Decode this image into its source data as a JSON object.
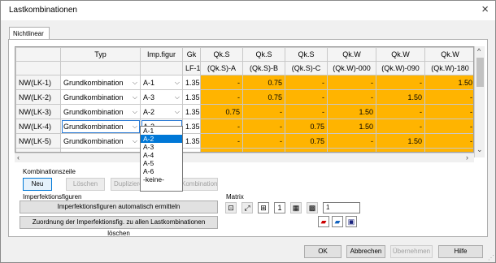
{
  "window": {
    "title": "Lastkombinationen"
  },
  "tabs": [
    {
      "label": "Nichtlinear"
    }
  ],
  "table": {
    "headers_top": [
      "",
      "Typ",
      "Imp.figur",
      "Gk",
      "Qk.S",
      "Qk.S",
      "Qk.S",
      "Qk.W",
      "Qk.W",
      "Qk.W"
    ],
    "headers_sub": [
      "",
      "",
      "",
      "LF-1",
      "(Qk.S)-A",
      "(Qk.S)-B",
      "(Qk.S)-C",
      "(Qk.W)-000",
      "(Qk.W)-090",
      "(Qk.W)-180"
    ],
    "rows": [
      {
        "name": "NW(LK-1)",
        "typ": "Grundkombination",
        "imp": "A-1",
        "gk": "1.35",
        "v": [
          "-",
          "0.75",
          "-",
          "-",
          "-",
          "1.50"
        ]
      },
      {
        "name": "NW(LK-2)",
        "typ": "Grundkombination",
        "imp": "A-3",
        "gk": "1.35",
        "v": [
          "-",
          "0.75",
          "-",
          "-",
          "1.50",
          "-"
        ]
      },
      {
        "name": "NW(LK-3)",
        "typ": "Grundkombination",
        "imp": "A-2",
        "gk": "1.35",
        "v": [
          "0.75",
          "-",
          "-",
          "1.50",
          "-",
          "-"
        ]
      },
      {
        "name": "NW(LK-4)",
        "typ": "Grundkombination",
        "imp": "A-2",
        "gk": "1.35",
        "v": [
          "-",
          "-",
          "0.75",
          "1.50",
          "-",
          "-"
        ]
      },
      {
        "name": "NW(LK-5)",
        "typ": "Grundkombination",
        "imp": "A-1",
        "gk": "1.35",
        "v": [
          "-",
          "-",
          "0.75",
          "-",
          "1.50",
          "-"
        ]
      },
      {
        "name": "NW(LK-6)",
        "typ": "Grundkombination",
        "imp": "",
        "gk": "1.35",
        "v": [
          "-",
          "-",
          "0.75",
          "-",
          "-",
          "-"
        ]
      }
    ]
  },
  "dropdown": {
    "options": [
      "A-1",
      "A-2",
      "A-3",
      "A-4",
      "A-5",
      "A-6",
      "-keine-"
    ],
    "selected": "A-2"
  },
  "kombinationszeile": {
    "label": "Kombinationszeile",
    "buttons": {
      "neu": "Neu",
      "loeschen": "Löschen",
      "duplizieren": "Duplizieren",
      "kombination": "Kombination"
    }
  },
  "imperfektion": {
    "label": "Imperfektionsfiguren",
    "auto_button": "Imperfektionsfiguren automatisch ermitteln",
    "clear_button": "Zuordnung der Imperfektionsfig. zu allen Lastkombinationen löschen"
  },
  "matrix": {
    "label": "Matrix",
    "value": "1"
  },
  "footer": {
    "ok": "OK",
    "abbrechen": "Abbrechen",
    "uebernehmen": "Übernehmen",
    "hilfe": "Hilfe"
  },
  "icons": {
    "close": "×",
    "chevron": "⌵",
    "left": "‹",
    "right": "›",
    "up": "^",
    "down": "⌄"
  }
}
